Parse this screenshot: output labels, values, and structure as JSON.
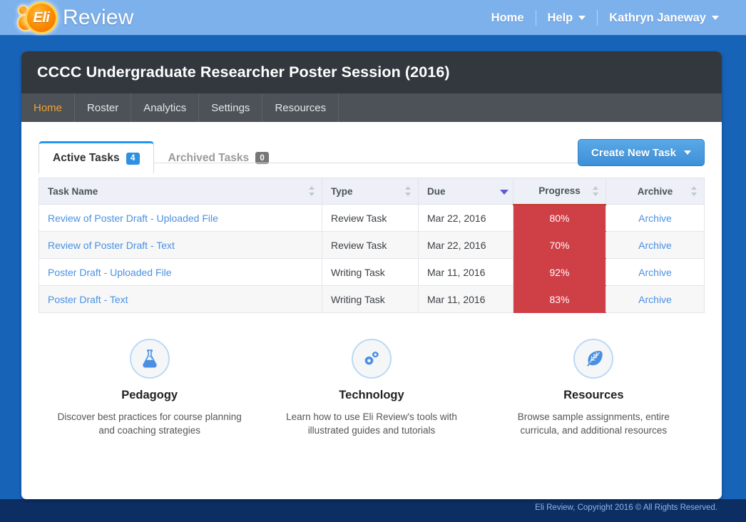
{
  "brand": {
    "mark_text": "Eli",
    "word": "Review"
  },
  "topnav": {
    "home": "Home",
    "help": "Help",
    "user": "Kathryn Janeway"
  },
  "course": {
    "title": "CCCC Undergraduate Researcher Poster Session (2016)",
    "nav": [
      {
        "label": "Home",
        "active": true
      },
      {
        "label": "Roster",
        "active": false
      },
      {
        "label": "Analytics",
        "active": false
      },
      {
        "label": "Settings",
        "active": false
      },
      {
        "label": "Resources",
        "active": false
      }
    ]
  },
  "tabs": [
    {
      "label": "Active Tasks",
      "count": "4",
      "active": true
    },
    {
      "label": "Archived Tasks",
      "count": "0",
      "active": false
    }
  ],
  "create_button": {
    "label": "Create New Task"
  },
  "table": {
    "columns": [
      {
        "label": "Task Name",
        "sorted": false
      },
      {
        "label": "Type",
        "sorted": false
      },
      {
        "label": "Due",
        "sorted": true
      },
      {
        "label": "Progress",
        "sorted": false
      },
      {
        "label": "Archive",
        "sorted": false
      }
    ],
    "rows": [
      {
        "task": "Review of Poster Draft - Uploaded File",
        "type": "Review Task",
        "due": "Mar 22, 2016",
        "progress": "80%",
        "archive": "Archive"
      },
      {
        "task": "Review of Poster Draft - Text",
        "type": "Review Task",
        "due": "Mar 22, 2016",
        "progress": "70%",
        "archive": "Archive"
      },
      {
        "task": "Poster Draft - Uploaded File",
        "type": "Writing Task",
        "due": "Mar 11, 2016",
        "progress": "92%",
        "archive": "Archive"
      },
      {
        "task": "Poster Draft - Text",
        "type": "Writing Task",
        "due": "Mar 11, 2016",
        "progress": "83%",
        "archive": "Archive"
      }
    ]
  },
  "features": [
    {
      "icon": "flask-icon",
      "title": "Pedagogy",
      "desc": "Discover best practices for course planning and coaching strategies"
    },
    {
      "icon": "gears-icon",
      "title": "Technology",
      "desc": "Learn how to use Eli Review's tools with illustrated guides and tutorials"
    },
    {
      "icon": "feather-icon",
      "title": "Resources",
      "desc": "Browse sample assignments, entire curricula, and additional resources"
    }
  ],
  "footer": {
    "text": "Eli Review, Copyright 2016 © All Rights Reserved."
  },
  "colors": {
    "brand_blue": "#1763b8",
    "header_blue": "#7db1ec",
    "footer_navy": "#0c2e63",
    "title_dark": "#32383e",
    "nav_dark": "#4c5257",
    "accent_orange": "#f0a030",
    "link_blue": "#4a90e2",
    "progress_red": "#cf3f46",
    "tab_blue": "#2196f3"
  }
}
